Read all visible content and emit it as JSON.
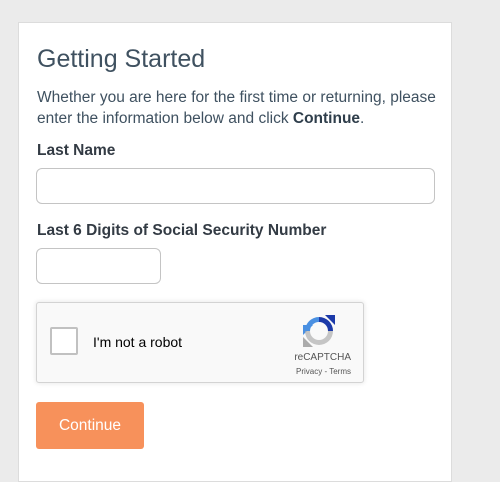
{
  "form": {
    "title": "Getting Started",
    "intro_text": "Whether you are here for the first time or returning, please enter the information below and click ",
    "intro_emphasis": "Continue",
    "intro_end": ".",
    "last_name_label": "Last Name",
    "last_name_value": "",
    "ssn_label": "Last 6 Digits of Social Security Number",
    "ssn_value": "",
    "submit_label": "Continue"
  },
  "recaptcha": {
    "checkbox_label": "I'm not a robot",
    "checked": false,
    "brand": "reCAPTCHA",
    "privacy_link": "Privacy",
    "separator": " - ",
    "terms_link": "Terms",
    "icon": "recaptcha-logo-icon"
  },
  "colors": {
    "page_background": "#ebebeb",
    "card_background": "#ffffff",
    "title_text": "#3f5160",
    "button_background": "#f7915b",
    "button_text": "#ffffff"
  }
}
